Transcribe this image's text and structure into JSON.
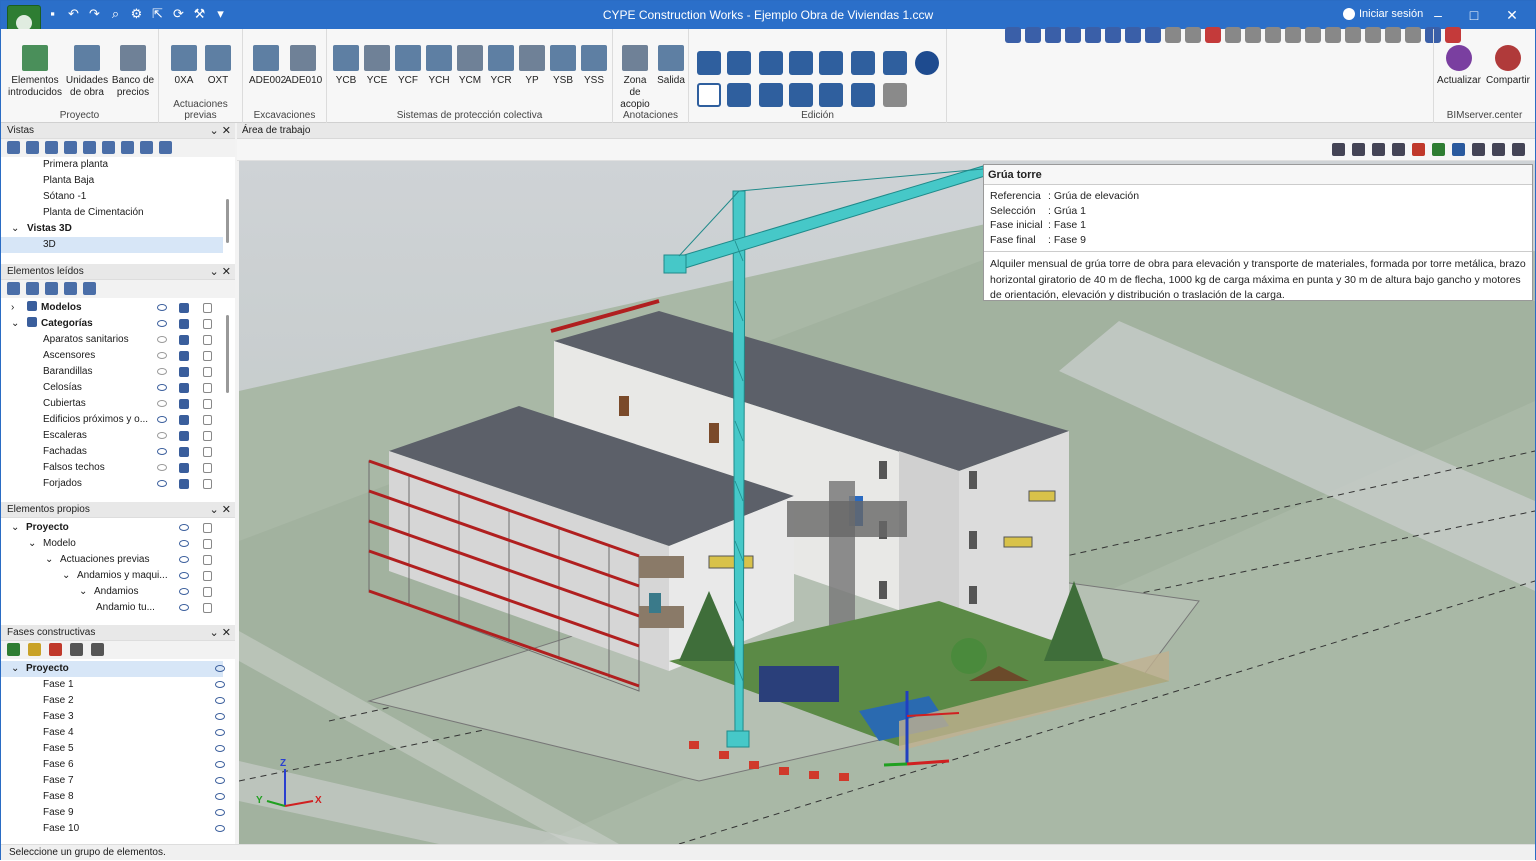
{
  "window": {
    "title": "CYPE Construction Works - Ejemplo Obra de Viviendas 1.ccw",
    "login_label": "Iniciar sesión",
    "controls": [
      "–",
      "□",
      "✕"
    ]
  },
  "ribbon": {
    "groups": [
      {
        "label": "Proyecto",
        "buttons": [
          "Elementos introducidos",
          "Unidades de obra",
          "Banco de precios"
        ]
      },
      {
        "label": "Actuaciones previas",
        "buttons": [
          "0XA",
          "OXT"
        ]
      },
      {
        "label": "Excavaciones",
        "buttons": [
          "ADE002",
          "ADE010"
        ]
      },
      {
        "label": "Sistemas de protección colectiva",
        "buttons": [
          "YCB",
          "YCE",
          "YCF",
          "YCH",
          "YCM",
          "YCR",
          "YP",
          "YSB",
          "YSS"
        ]
      },
      {
        "label": "Anotaciones",
        "buttons": [
          "Zona de acopio",
          "Salida"
        ]
      },
      {
        "label": "Edición",
        "buttons": []
      },
      {
        "label": "BIMserver.center",
        "buttons": [
          "Actualizar",
          "Compartir"
        ]
      }
    ]
  },
  "panels": {
    "vistas": {
      "title": "Vistas",
      "items": [
        {
          "label": "Primera planta",
          "indent": 2
        },
        {
          "label": "Planta Baja",
          "indent": 2
        },
        {
          "label": "Sótano -1",
          "indent": 2
        },
        {
          "label": "Planta de Cimentación",
          "indent": 2
        },
        {
          "label": "Vistas 3D",
          "indent": 1,
          "bold": true,
          "chevron": "⌄"
        },
        {
          "label": "3D",
          "indent": 2,
          "selected": true
        }
      ]
    },
    "elementos_leidos": {
      "title": "Elementos leídos",
      "items": [
        {
          "label": "Modelos",
          "bold": true,
          "chevron": "›",
          "eye": true
        },
        {
          "label": "Categorías",
          "bold": true,
          "chevron": "⌄",
          "eye": true
        },
        {
          "label": "Aparatos sanitarios",
          "eye": false
        },
        {
          "label": "Ascensores",
          "eye": false
        },
        {
          "label": "Barandillas",
          "eye": false
        },
        {
          "label": "Celosías",
          "eye": true
        },
        {
          "label": "Cubiertas",
          "eye": false
        },
        {
          "label": "Edificios próximos y o...",
          "eye": true
        },
        {
          "label": "Escaleras",
          "eye": false
        },
        {
          "label": "Fachadas",
          "eye": true
        },
        {
          "label": "Falsos techos",
          "eye": false
        },
        {
          "label": "Forjados",
          "eye": true
        }
      ]
    },
    "elementos_propios": {
      "title": "Elementos propios",
      "items": [
        {
          "label": "Proyecto",
          "level": 0
        },
        {
          "label": "Modelo",
          "level": 1
        },
        {
          "label": "Actuaciones previas",
          "level": 2
        },
        {
          "label": "Andamios y maqui...",
          "level": 3
        },
        {
          "label": "Andamios",
          "level": 4
        },
        {
          "label": "Andamio tu...",
          "level": 5
        }
      ]
    },
    "fases": {
      "title": "Fases constructivas",
      "items": [
        "Proyecto",
        "Fase 1",
        "Fase 2",
        "Fase 3",
        "Fase 4",
        "Fase 5",
        "Fase 6",
        "Fase 7",
        "Fase 8",
        "Fase 9",
        "Fase 10"
      ]
    }
  },
  "workarea": {
    "title": "Área de trabajo",
    "axes": {
      "x": "X",
      "y": "Y",
      "z": "Z"
    }
  },
  "tooltip": {
    "title": "Grúa torre",
    "props": [
      {
        "key": "Referencia",
        "value": ": Grúa de elevación"
      },
      {
        "key": "Selección",
        "value": ": Grúa 1"
      },
      {
        "key": "Fase inicial",
        "value": ": Fase 1"
      },
      {
        "key": "Fase final",
        "value": ": Fase 9"
      }
    ],
    "description": "Alquiler mensual de grúa torre de obra para elevación y transporte de materiales, formada por torre metálica, brazo horizontal giratorio de 40 m de flecha, 1000 kg de carga máxima en punta y 30 m de altura bajo gancho y motores de orientación, elevación y distribución o traslación de la carga."
  },
  "status": "Seleccione un grupo de elementos.",
  "colors": {
    "titlebar": "#2b6fc9",
    "crane": "#46c8c8",
    "roof": "#606570",
    "selection": "#d7e6f7"
  }
}
